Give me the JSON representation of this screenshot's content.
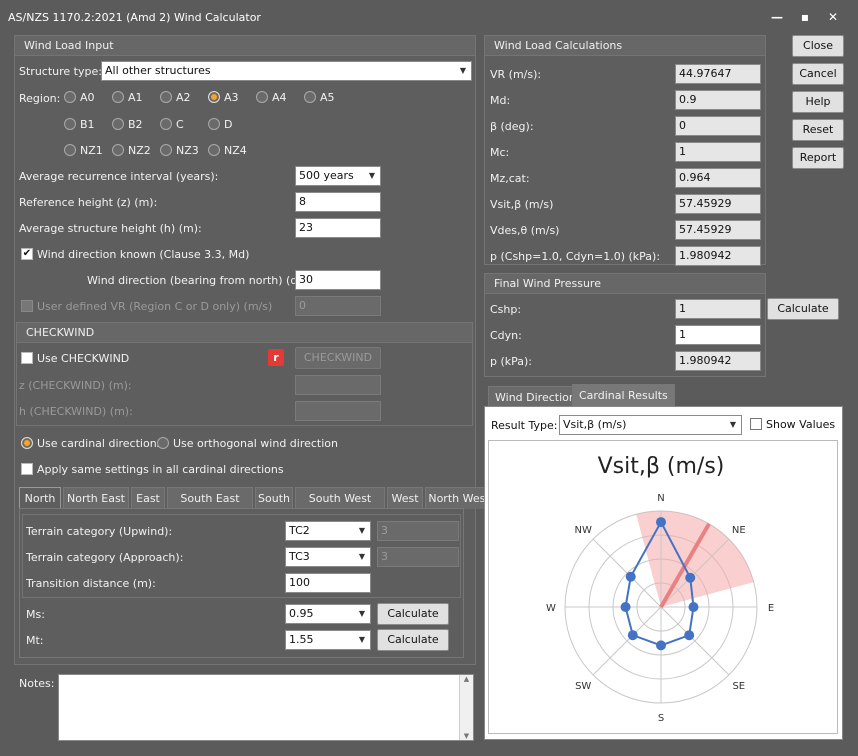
{
  "window": {
    "title": "AS/NZS 1170.2:2021 (Amd 2) Wind Calculator"
  },
  "input": {
    "header": "Wind Load Input",
    "structure_label": "Structure type:",
    "structure_value": "All other structures",
    "region_label": "Region:",
    "regions": [
      "A0",
      "A1",
      "A2",
      "A3",
      "A4",
      "A5",
      "B1",
      "B2",
      "C",
      "D",
      "NZ1",
      "NZ2",
      "NZ3",
      "NZ4"
    ],
    "region_selected": "A3",
    "ari_label": "Average recurrence interval (years):",
    "ari_value": "500 years",
    "refheight_label": "Reference height (z) (m):",
    "refheight_value": "8",
    "avgheight_label": "Average structure height (h) (m):",
    "avgheight_value": "23",
    "winddir_known_label": "Wind direction known (Clause 3.3, Md)",
    "winddir_label": "Wind direction (bearing from north) (deg):",
    "winddir_value": "30",
    "userdef_label": "User defined VR (Region C or D only) (m/s)",
    "userdef_value": "0"
  },
  "checkwind": {
    "header": "CHECKWIND",
    "use_label": "Use CHECKWIND",
    "button": "CHECKWIND",
    "z_label": "z (CHECKWIND) (m):",
    "h_label": "h (CHECKWIND) (m):"
  },
  "directions": {
    "cardinal_label": "Use cardinal directions",
    "orthogonal_label": "Use orthogonal wind direction",
    "same_settings_label": "Apply same settings in all cardinal directions",
    "tabs": [
      "North",
      "North East",
      "East",
      "South East",
      "South",
      "South West",
      "West",
      "North West"
    ],
    "terrain_upwind_label": "Terrain category (Upwind):",
    "terrain_upwind_value": "TC2",
    "terrain_upwind_num": "3",
    "terrain_approach_label": "Terrain category (Approach):",
    "terrain_approach_value": "TC3",
    "terrain_approach_num": "3",
    "transition_label": "Transition distance (m):",
    "transition_value": "100",
    "ms_label": "Ms:",
    "ms_value": "0.95",
    "mt_label": "Mt:",
    "mt_value": "1.55",
    "calc_label": "Calculate"
  },
  "notes_label": "Notes:",
  "calc": {
    "header": "Wind Load Calculations",
    "rows": [
      {
        "label": "VR (m/s):",
        "value": "44.97647"
      },
      {
        "label": "Md:",
        "value": "0.9"
      },
      {
        "label": "β (deg):",
        "value": "0"
      },
      {
        "label": "Mc:",
        "value": "1"
      },
      {
        "label": "Mz,cat:",
        "value": "0.964"
      },
      {
        "label": "Vsit,β (m/s)",
        "value": "57.45929"
      },
      {
        "label": "Vdes,θ (m/s)",
        "value": "57.45929"
      },
      {
        "label": "p (Cshp=1.0, Cdyn=1.0) (kPa):",
        "value": "1.980942"
      }
    ]
  },
  "final": {
    "header": "Final Wind Pressure",
    "cshp_label": "Cshp:",
    "cshp_value": "1",
    "cdyn_label": "Cdyn:",
    "cdyn_value": "1",
    "p_label": "p (kPa):",
    "p_value": "1.980942",
    "calc_button": "Calculate"
  },
  "buttons": {
    "close": "Close",
    "cancel": "Cancel",
    "help": "Help",
    "reset": "Reset",
    "report": "Report"
  },
  "results": {
    "tab_wind_direction": "Wind Direction",
    "tab_cardinal": "Cardinal Results",
    "result_type_label": "Result Type:",
    "result_type_value": "Vsit,β (m/s)",
    "show_values_label": "Show Values"
  },
  "chart_data": {
    "type": "radar",
    "title": "Vsit,β (m/s)",
    "categories": [
      "N",
      "NE",
      "E",
      "SE",
      "S",
      "SW",
      "W",
      "NW"
    ],
    "values": [
      57.5,
      28,
      22,
      27,
      26,
      27,
      24,
      29
    ],
    "rmax": 65,
    "rings": 4,
    "wind_direction_deg": 30,
    "sector_halfwidth_deg": 45,
    "colors": {
      "series": "#4472c4",
      "sector": "#f4a7a7",
      "direction": "#e57373",
      "grid": "#c8c8c8"
    }
  }
}
